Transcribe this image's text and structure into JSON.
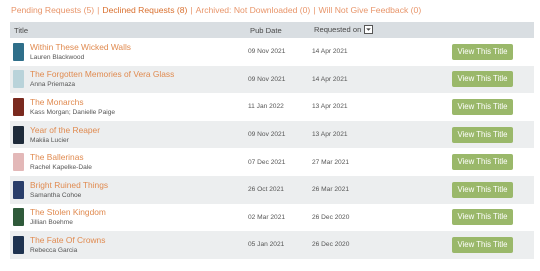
{
  "tabs": [
    {
      "label": "Pending Requests (5)",
      "active": false
    },
    {
      "label": "Declined Requests (8)",
      "active": true
    },
    {
      "label": "Archived: Not Downloaded (0)",
      "active": false
    },
    {
      "label": "Will Not Give Feedback (0)",
      "active": false
    }
  ],
  "separator": "|",
  "columns": {
    "title": "Title",
    "pub_date": "Pub Date",
    "requested_on": "Requested on"
  },
  "sort_icon": "chevron-down-icon",
  "button_label": "View This Title",
  "rows": [
    {
      "title": "Within These Wicked Walls",
      "author": "Lauren Blackwood",
      "pub_date": "09 Nov 2021",
      "requested_on": "14 Apr 2021",
      "cover_color": "#2f6f8a"
    },
    {
      "title": "The Forgotten Memories of Vera Glass",
      "author": "Anna Priemaza",
      "pub_date": "09 Nov 2021",
      "requested_on": "14 Apr 2021",
      "cover_color": "#b9d3da"
    },
    {
      "title": "The Monarchs",
      "author": "Kass Morgan; Danielle Paige",
      "pub_date": "11 Jan 2022",
      "requested_on": "13 Apr 2021",
      "cover_color": "#7a2a1f"
    },
    {
      "title": "Year of the Reaper",
      "author": "Makiia Lucier",
      "pub_date": "09 Nov 2021",
      "requested_on": "13 Apr 2021",
      "cover_color": "#1e2b3a"
    },
    {
      "title": "The Ballerinas",
      "author": "Rachel Kapelke-Dale",
      "pub_date": "07 Dec 2021",
      "requested_on": "27 Mar 2021",
      "cover_color": "#e3b8b8"
    },
    {
      "title": "Bright Ruined Things",
      "author": "Samantha Cohoe",
      "pub_date": "26 Oct 2021",
      "requested_on": "26 Mar 2021",
      "cover_color": "#2a3e6a"
    },
    {
      "title": "The Stolen Kingdom",
      "author": "Jillian Boehme",
      "pub_date": "02 Mar 2021",
      "requested_on": "26 Dec 2020",
      "cover_color": "#2f5a3a"
    },
    {
      "title": "The Fate Of Crowns",
      "author": "Rebecca Garcia",
      "pub_date": "05 Jan 2021",
      "requested_on": "26 Dec 2020",
      "cover_color": "#1f3350"
    }
  ]
}
